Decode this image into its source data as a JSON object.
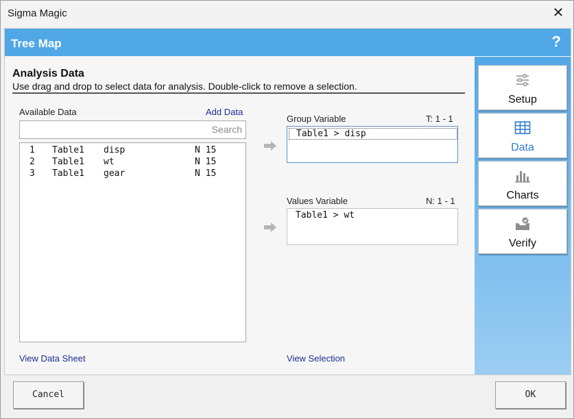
{
  "window": {
    "title": "Sigma Magic",
    "close_glyph": "✕"
  },
  "header": {
    "title": "Tree Map",
    "help_glyph": "?"
  },
  "nav": {
    "items": [
      {
        "label": "Setup",
        "icon": "sliders-icon",
        "active": false
      },
      {
        "label": "Data",
        "icon": "table-icon",
        "active": true
      },
      {
        "label": "Charts",
        "icon": "bar-chart-icon",
        "active": false
      },
      {
        "label": "Verify",
        "icon": "inbox-check-icon",
        "active": false
      }
    ],
    "accent_color": "#2f7bd0"
  },
  "section": {
    "title": "Analysis Data",
    "subtitle": "Use drag and drop to select data for analysis. Double-click to remove a selection."
  },
  "available": {
    "label": "Available Data",
    "add_link": "Add Data",
    "search_placeholder": "Search",
    "rows": [
      {
        "num": "1",
        "table": "Table1",
        "col": "disp",
        "type": "N 15"
      },
      {
        "num": "2",
        "table": "Table1",
        "col": "wt",
        "type": "N 15"
      },
      {
        "num": "3",
        "table": "Table1",
        "col": "gear",
        "type": "N 15"
      }
    ],
    "view_link": "View Data Sheet"
  },
  "group_var": {
    "label": "Group Variable",
    "count": "T: 1 - 1",
    "items": [
      "Table1 > disp"
    ]
  },
  "values_var": {
    "label": "Values Variable",
    "count": "N: 1 - 1",
    "items": [
      "Table1 > wt"
    ]
  },
  "view_selection": "View Selection",
  "buttons": {
    "cancel": "Cancel",
    "ok": "OK"
  },
  "colors": {
    "header": "#4fa7e6",
    "link": "#1b2f8f"
  }
}
